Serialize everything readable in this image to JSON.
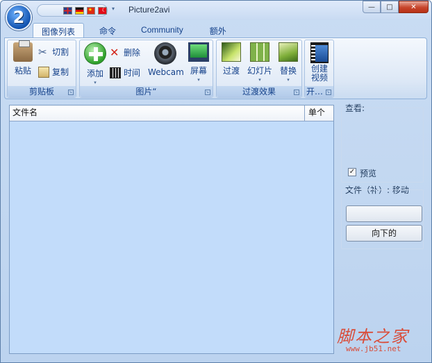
{
  "window": {
    "title": "Picture2avi",
    "orb_text": "2",
    "controls": {
      "minimize": "—",
      "maximize": "□",
      "close": "✕"
    }
  },
  "quick_access": {
    "flags": [
      "flag-uk",
      "flag-de",
      "flag-cn",
      "flag-tr"
    ],
    "dropdown": "▾"
  },
  "tabs": [
    {
      "label": "图像列表",
      "active": true
    },
    {
      "label": "命令"
    },
    {
      "label": "Community"
    },
    {
      "label": "额外"
    }
  ],
  "ribbon": {
    "clipboard": {
      "label": "剪贴板",
      "paste": "粘贴",
      "cut": "切割",
      "copy": "复制"
    },
    "pictures": {
      "label": "图片“",
      "add": "添加",
      "delete": "删除",
      "time": "时间",
      "webcam": "Webcam",
      "screen": "屏幕"
    },
    "transitions": {
      "label": "过渡效果",
      "transition": "过渡",
      "slideshow": "幻灯片",
      "replace": "替换"
    },
    "open": {
      "label": "开…",
      "create_video": "创建",
      "create_video_2": "视频"
    }
  },
  "list": {
    "columns": [
      "文件名",
      "单个"
    ]
  },
  "side": {
    "view_label": "查看:",
    "preview_label": "预览",
    "preview_checked": "✓",
    "file_move_label": "文件（补）: 移动",
    "up_button": "",
    "down_button": "向下的"
  },
  "watermark": {
    "text": "脚本之家",
    "url": "www.jb51.net"
  },
  "colors": {
    "list_bg": "#c2dcfa",
    "ribbon_accent": "#15428b",
    "close_button": "#c7452b"
  }
}
